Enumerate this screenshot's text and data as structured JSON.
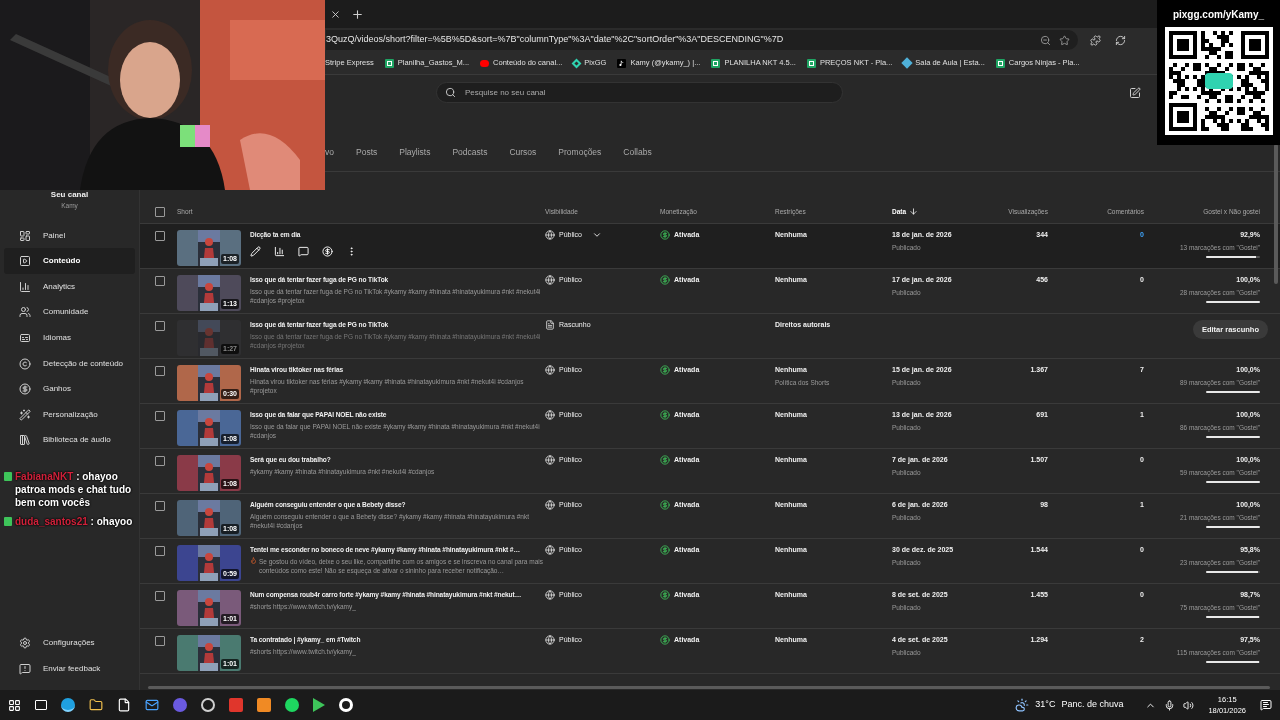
{
  "browser": {
    "address": "3QuzQ/videos/short?filter=%5B%5D&sort=%7B\"columnType\"%3A\"date\"%2C\"sortOrder\"%3A\"DESCENDING\"%7D",
    "bookmarks": [
      {
        "label": "Stripe Express"
      },
      {
        "label": "Planilha_Gastos_M..."
      },
      {
        "label": "Conteúdo do canal..."
      },
      {
        "label": "PixGG"
      },
      {
        "label": "Kamy (@ykamy_) |..."
      },
      {
        "label": "PLANILHA NKT 4.5..."
      },
      {
        "label": "PREÇOS NKT - Pla..."
      },
      {
        "label": "Sala de Aula | Esta..."
      },
      {
        "label": "Cargos Ninjas - Pla..."
      }
    ]
  },
  "overlay": {
    "qr_caption": "pixgg.com/yKamy_",
    "chat": [
      {
        "user": "FabianaNKT",
        "separator": ":",
        "message": "ohayoo patroa mods e chat tudo bem com vocês"
      },
      {
        "user": "duda_santos21",
        "separator": ":",
        "message": "ohayoo"
      }
    ]
  },
  "search": {
    "placeholder": "Pesquise no seu canal"
  },
  "sidebar": {
    "title": "Seu canal",
    "subtitle": "Kamy",
    "items": [
      {
        "label": "Painel",
        "selected": false
      },
      {
        "label": "Conteúdo",
        "selected": true
      },
      {
        "label": "Analytics",
        "selected": false
      },
      {
        "label": "Comunidade",
        "selected": false
      },
      {
        "label": "Idiomas",
        "selected": false
      },
      {
        "label": "Detecção de conteúdo",
        "selected": false
      },
      {
        "label": "Ganhos",
        "selected": false
      },
      {
        "label": "Personalização",
        "selected": false
      },
      {
        "label": "Biblioteca de áudio",
        "selected": false
      }
    ],
    "footer_items": [
      {
        "label": "Configurações"
      },
      {
        "label": "Enviar feedback"
      }
    ]
  },
  "tabs": [
    {
      "label": "vo",
      "selected": false
    },
    {
      "label": "Posts",
      "selected": false
    },
    {
      "label": "Playlists",
      "selected": false
    },
    {
      "label": "Podcasts",
      "selected": false
    },
    {
      "label": "Cursos",
      "selected": false
    },
    {
      "label": "Promoções",
      "selected": false
    },
    {
      "label": "Collabs",
      "selected": false
    }
  ],
  "table": {
    "select_all_checked": false,
    "columns": [
      {
        "label": "Short",
        "sorted": false
      },
      {
        "label": "Visibilidade",
        "sorted": false
      },
      {
        "label": "Monetização",
        "sorted": false
      },
      {
        "label": "Restrições",
        "sorted": false
      },
      {
        "label": "Data",
        "sorted": true
      },
      {
        "label": "Visualizações",
        "sorted": false
      },
      {
        "label": "Comentários",
        "sorted": false
      },
      {
        "label": "Gostei x Não gostei",
        "sorted": false
      }
    ],
    "rows": [
      {
        "kind": "published",
        "checked": false,
        "hovered": true,
        "title": "Dicção ta em dia",
        "duration": "1:08",
        "visibility": "Público",
        "monetization": "Ativada",
        "restrictions": "Nenhuma",
        "date": "18 de jan. de 2026",
        "date_status": "Publicado",
        "views": "344",
        "comments": "0",
        "likes": "92,9%",
        "likes_caption": "13 marcações com \"Gostei\"",
        "level": 0.929
      },
      {
        "kind": "published",
        "checked": false,
        "hovered": false,
        "title": "Isso que dá tentar fazer fuga de PG no TikTok",
        "description": "Isso que dá tentar fazer fuga de PG no TikTok #ykamy #kamy #hinata #hinatayukimura #nkt #nekut4i #cdanjos #projetox",
        "duration": "1:13",
        "visibility": "Público",
        "monetization": "Ativada",
        "restrictions": "Nenhuma",
        "date": "17 de jan. de 2026",
        "date_status": "Publicado",
        "views": "456",
        "comments": "0",
        "likes": "100,0%",
        "likes_caption": "28 marcações com \"Gostei\"",
        "level": 1
      },
      {
        "kind": "draft",
        "checked": false,
        "hovered": false,
        "title": "Isso que dá tentar fazer fuga de PG no TikTok",
        "description": "Isso que dá tentar fazer fuga de PG no TikTok #ykamy #kamy #hinata #hinatayukimura #nkt #nekut4i #cdanjos #projetox",
        "duration": "1:27",
        "visibility": "Rascunho",
        "restrictions": "Direitos autorais",
        "action": "Editar rascunho"
      },
      {
        "kind": "published",
        "checked": false,
        "hovered": false,
        "title": "Hinata virou tiktoker nas férias",
        "description": "Hinata virou tiktoker nas férias #ykamy #kamy #hinata #hinatayukimura #nkt #nekut4i #cdanjos #projetox",
        "duration": "0:30",
        "visibility": "Público",
        "monetization": "Ativada",
        "restrictions": "Nenhuma",
        "restrictions_note": "Política dos Shorts",
        "date": "15 de jan. de 2026",
        "date_status": "Publicado",
        "views": "1.367",
        "comments": "7",
        "likes": "100,0%",
        "likes_caption": "89 marcações com \"Gostei\"",
        "level": 1
      },
      {
        "kind": "published",
        "checked": false,
        "hovered": false,
        "title": "Isso que da falar que PAPAI NOEL não existe",
        "description": "Isso que da falar que PAPAI NOEL não existe #ykamy #kamy #hinata #hinatayukimura #nkt #nekut4i #cdanjos",
        "duration": "1:08",
        "visibility": "Público",
        "monetization": "Ativada",
        "restrictions": "Nenhuma",
        "date": "13 de jan. de 2026",
        "date_status": "Publicado",
        "views": "691",
        "comments": "1",
        "likes": "100,0%",
        "likes_caption": "86 marcações com \"Gostei\"",
        "level": 1
      },
      {
        "kind": "published",
        "checked": false,
        "hovered": false,
        "title": "Será que eu dou trabalho?",
        "description": "#ykamy #kamy #hinata #hinatayukimura #nkt #nekut4i #cdanjos",
        "duration": "1:08",
        "visibility": "Público",
        "monetization": "Ativada",
        "restrictions": "Nenhuma",
        "date": "7 de jan. de 2026",
        "date_status": "Publicado",
        "views": "1.507",
        "comments": "0",
        "likes": "100,0%",
        "likes_caption": "59 marcações com \"Gostei\"",
        "level": 1
      },
      {
        "kind": "published",
        "checked": false,
        "hovered": false,
        "title": "Alguém conseguiu entender o que a Bebety disse?",
        "description": "Alguém conseguiu entender o que a Bebety disse? #ykamy #kamy #hinata #hinatayukimura #nkt #nekut4i #cdanjos",
        "duration": "1:08",
        "visibility": "Público",
        "monetization": "Ativada",
        "restrictions": "Nenhuma",
        "date": "6 de jan. de 2026",
        "date_status": "Publicado",
        "views": "98",
        "comments": "1",
        "likes": "100,0%",
        "likes_caption": "21 marcações com \"Gostei\"",
        "level": 1
      },
      {
        "kind": "published",
        "checked": false,
        "hovered": false,
        "title": "Tentei me esconder no boneco de neve #ykamy #kamy #hinata #hinatayukimura #nkt #…",
        "description": "Se gostou do vídeo, deixe o seu like, compartilhe com os amigos e se inscreva no canal para mais conteúdos como este! Não se esqueça de ativar o sininho para receber notificação…",
        "description_flame": true,
        "duration": "0:59",
        "visibility": "Público",
        "monetization": "Ativada",
        "restrictions": "Nenhuma",
        "date": "30 de dez. de 2025",
        "date_status": "Publicado",
        "views": "1.544",
        "comments": "0",
        "likes": "95,8%",
        "likes_caption": "23 marcações com \"Gostei\"",
        "level": 0.958
      },
      {
        "kind": "published",
        "checked": false,
        "hovered": false,
        "title": "Num compensa roub4r carro forte #ykamy #kamy #hinata #hinatayukimura #nkt #nekut…",
        "description": "#shorts https://www.twitch.tv/ykamy_",
        "duration": "1:01",
        "visibility": "Público",
        "monetization": "Ativada",
        "restrictions": "Nenhuma",
        "date": "8 de set. de 2025",
        "date_status": "Publicado",
        "views": "1.455",
        "comments": "0",
        "likes": "98,7%",
        "likes_caption": "75 marcações com \"Gostei\"",
        "level": 0.987
      },
      {
        "kind": "published",
        "checked": false,
        "hovered": false,
        "title": "Ta contratado | #ykamy_ em #Twitch",
        "description": "#shorts https://www.twitch.tv/ykamy_",
        "duration": "1:01",
        "visibility": "Público",
        "monetization": "Ativada",
        "restrictions": "Nenhuma",
        "date": "4 de set. de 2025",
        "date_status": "Publicado",
        "views": "1.294",
        "comments": "2",
        "likes": "97,5%",
        "likes_caption": "115 marcações com \"Gostei\"",
        "level": 0.975
      }
    ]
  },
  "taskbar": {
    "temperature": "31°C",
    "weather": "Panc. de chuva",
    "time": "16:15",
    "date": "18/01/2026"
  }
}
